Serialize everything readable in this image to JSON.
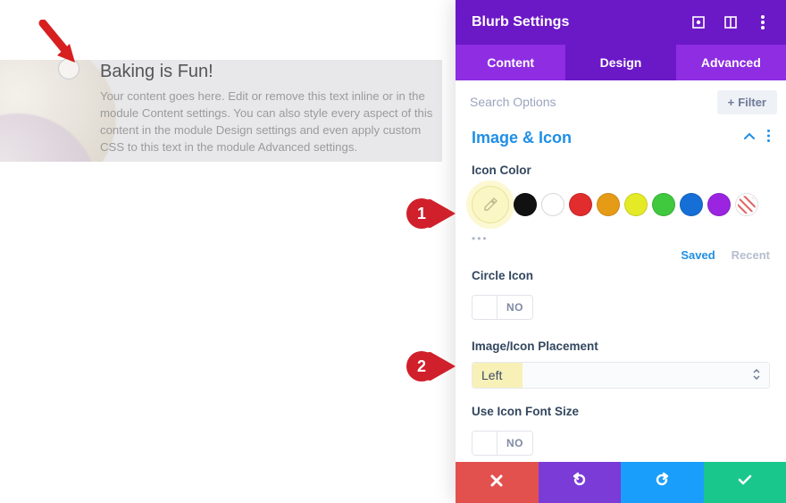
{
  "panel": {
    "title": "Blurb Settings",
    "tabs": {
      "content": "Content",
      "design": "Design",
      "advanced": "Advanced"
    },
    "active_tab": "Design"
  },
  "search": {
    "placeholder": "Search Options",
    "filter_label": "Filter"
  },
  "section": {
    "title": "Image & Icon"
  },
  "icon_color": {
    "label": "Icon Color",
    "swatches": [
      {
        "name": "eyedropper",
        "hex": "#fbf7c5"
      },
      {
        "name": "black",
        "hex": "#111111"
      },
      {
        "name": "white",
        "hex": "#ffffff"
      },
      {
        "name": "red",
        "hex": "#e12d2d"
      },
      {
        "name": "orange",
        "hex": "#e69b17"
      },
      {
        "name": "yellow",
        "hex": "#e5ea27"
      },
      {
        "name": "green",
        "hex": "#40c83e"
      },
      {
        "name": "blue",
        "hex": "#166fd6"
      },
      {
        "name": "purple",
        "hex": "#9a24e0"
      },
      {
        "name": "none",
        "hex": "none"
      }
    ],
    "more_dots": "•••",
    "saved": "Saved",
    "recent": "Recent"
  },
  "circle_icon": {
    "label": "Circle Icon",
    "value": false,
    "no": "NO"
  },
  "placement": {
    "label": "Image/Icon Placement",
    "value": "Left"
  },
  "use_font_size": {
    "label": "Use Icon Font Size",
    "value": false,
    "no": "NO"
  },
  "hero": {
    "title": "Baking is Fun!",
    "body": "Your content goes here. Edit or remove this text inline or in the module Content settings. You can also style every aspect of this content in the module Design settings and even apply custom CSS to this text in the module Advanced settings."
  },
  "callouts": {
    "one": "1",
    "two": "2"
  }
}
